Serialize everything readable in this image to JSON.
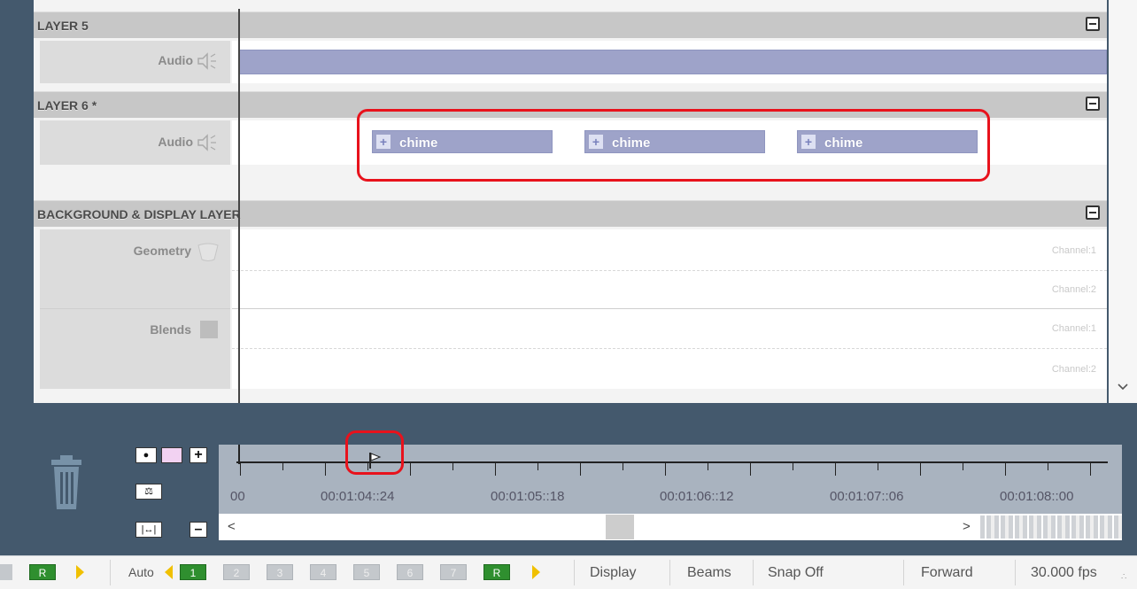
{
  "layers": {
    "layer5": {
      "title": "LAYER 5",
      "track_label": "Audio"
    },
    "layer6": {
      "title": "LAYER 6 *",
      "track_label": "Audio",
      "clips": [
        "chime",
        "chime",
        "chime"
      ]
    },
    "background": {
      "title": "BACKGROUND & DISPLAY LAYER",
      "geometry_label": "Geometry",
      "blends_label": "Blends",
      "channels": [
        "Channel:1",
        "Channel:2",
        "Channel:1",
        "Channel:2"
      ]
    }
  },
  "timeline": {
    "time_labels": [
      "00",
      "00:01:04::24",
      "00:01:05::18",
      "00:01:06::12",
      "00:01:07::06",
      "00:01:08::00"
    ],
    "scroll_left": "<",
    "scroll_right": ">"
  },
  "status_bar": {
    "left_r": "R",
    "auto_label": "Auto",
    "numbers": [
      "1",
      "2",
      "3",
      "4",
      "5",
      "6",
      "7"
    ],
    "right_r": "R",
    "display_label": "Display",
    "beams_label": "Beams",
    "snap_label": "Snap Off",
    "direction_label": "Forward",
    "fps_label": "30.000 fps"
  },
  "icons": {
    "audio": "speaker-icon",
    "collapse": "minus-icon",
    "trash": "trash-icon",
    "marker": "flag-icon",
    "add": "plus-icon",
    "remove": "minus-icon",
    "zoom_fit": "zoom-fit-icon",
    "balance": "balance-icon",
    "scroll_down": "chevron-down-icon"
  },
  "colors": {
    "clip_fill": "#9ea3c9",
    "highlight": "#e8121c",
    "active_green": "#2f8f2f",
    "background": "#44596d"
  }
}
